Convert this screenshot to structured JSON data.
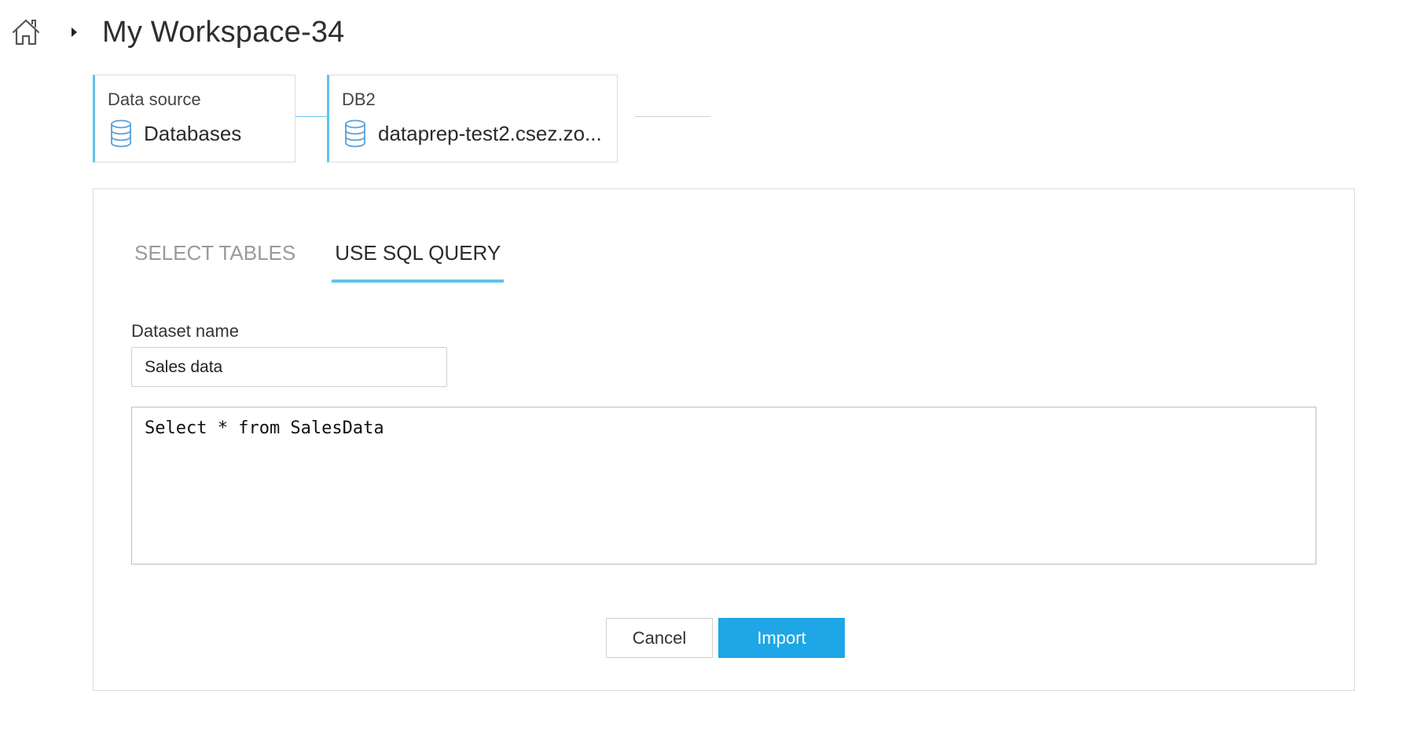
{
  "header": {
    "title": "My Workspace-34"
  },
  "steps": [
    {
      "label": "Data source",
      "value": "Databases"
    },
    {
      "label": "DB2",
      "value": "dataprep-test2.csez.zo..."
    }
  ],
  "tabs": [
    {
      "label": "SELECT TABLES",
      "active": false
    },
    {
      "label": "USE SQL QUERY",
      "active": true
    }
  ],
  "form": {
    "dataset_label": "Dataset name",
    "dataset_value": "Sales data",
    "query": "Select * from SalesData"
  },
  "actions": {
    "cancel_label": "Cancel",
    "import_label": "Import"
  },
  "colors": {
    "accent": "#61c3ea",
    "primary_button": "#1ea6e6"
  },
  "icons": {
    "home": "home-icon",
    "breadcrumb_separator": "caret-right-icon",
    "database": "database-icon"
  }
}
